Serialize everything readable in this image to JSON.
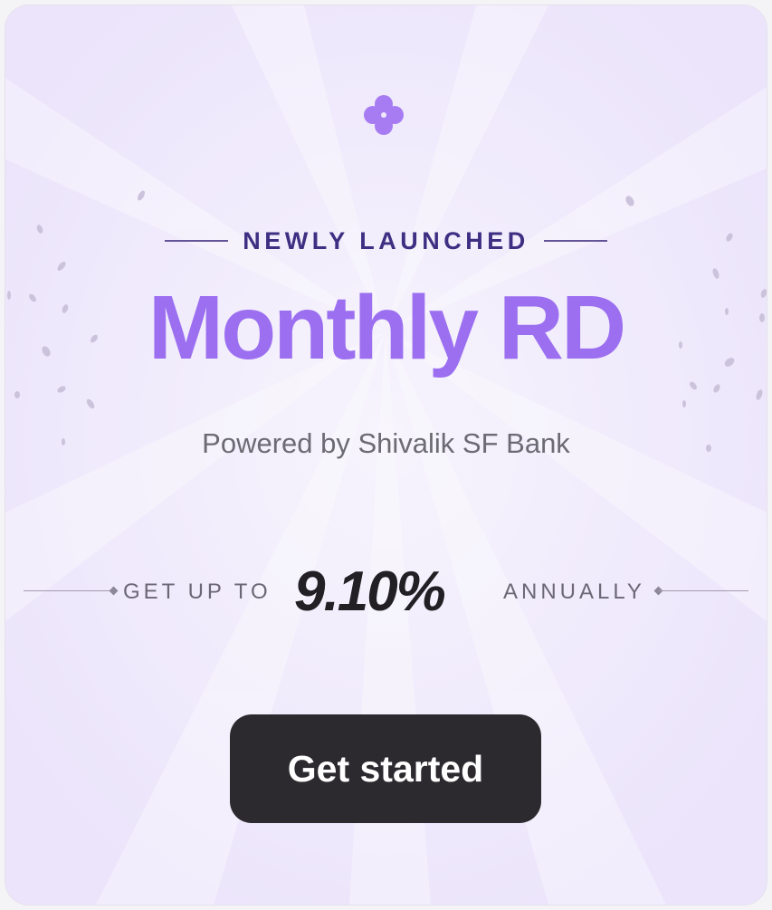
{
  "banner": {
    "badge": "NEWLY LAUNCHED",
    "title": "Monthly RD",
    "subtitle": "Powered by Shivalik SF Bank",
    "rate_prefix": "GET UP TO",
    "rate_value": "9.10%",
    "rate_suffix": "ANNUALLY",
    "cta_label": "Get started"
  },
  "icons": {
    "top": "four-petal-flower-icon"
  },
  "colors": {
    "card_background": "#efe9fb",
    "title": "#9b6ff0",
    "badge_text": "#3e2f83",
    "flower": "#a77cf3",
    "rate_value": "#222025",
    "button_background": "#2d2a2f",
    "button_text": "#ffffff",
    "muted_text": "#6c6a73"
  }
}
